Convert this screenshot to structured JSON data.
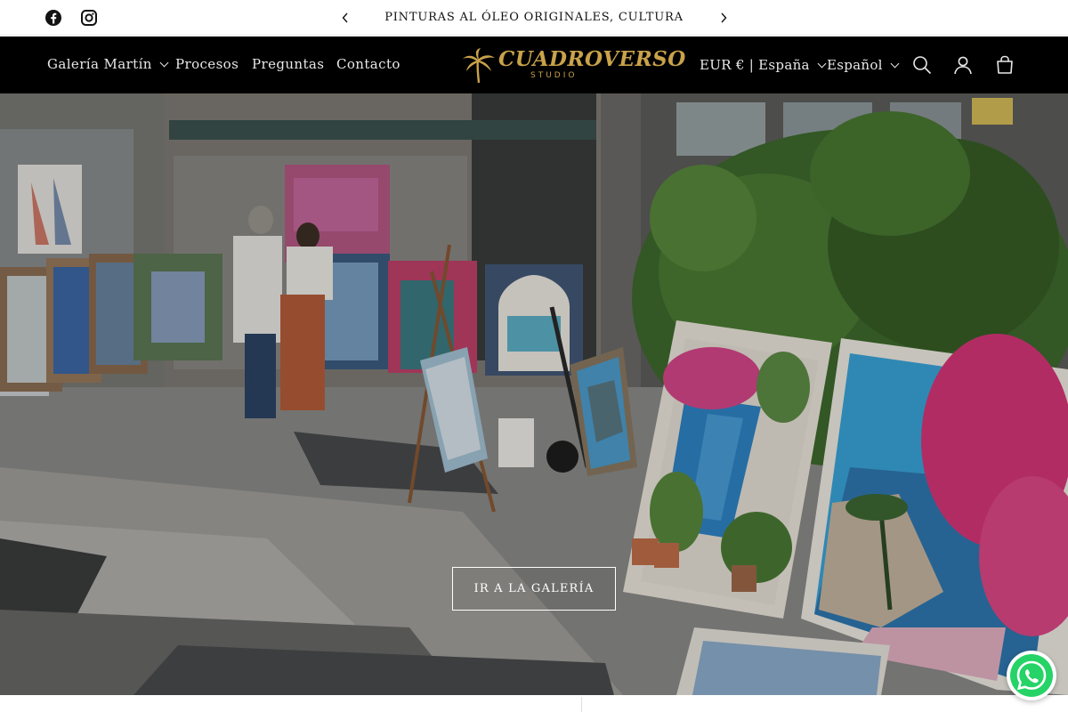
{
  "announcement": {
    "text": "PINTURAS AL ÓLEO ORIGINALES, CULTURA ESPAÑOLA",
    "prev_icon": "chevron-left-icon",
    "next_icon": "chevron-right-icon"
  },
  "social": [
    {
      "name": "facebook",
      "icon": "facebook-icon"
    },
    {
      "name": "instagram",
      "icon": "instagram-icon"
    }
  ],
  "nav": {
    "items": [
      {
        "label": "Galería Martín",
        "has_dropdown": true
      },
      {
        "label": "Procesos",
        "has_dropdown": false
      },
      {
        "label": "Preguntas",
        "has_dropdown": false
      },
      {
        "label": "Contacto",
        "has_dropdown": false
      }
    ]
  },
  "logo": {
    "word": "CUADROVERSO",
    "sub": "STUDIO",
    "color": "#c9a24a"
  },
  "header": {
    "currency": "EUR € | España",
    "language": "Español",
    "search_icon": "search-icon",
    "account_icon": "account-icon",
    "cart_icon": "cart-icon",
    "background": "#000000"
  },
  "hero": {
    "cta_label": "IR A LA GALERÍA"
  },
  "whatsapp": {
    "icon": "whatsapp-icon",
    "color": "#25d366"
  }
}
